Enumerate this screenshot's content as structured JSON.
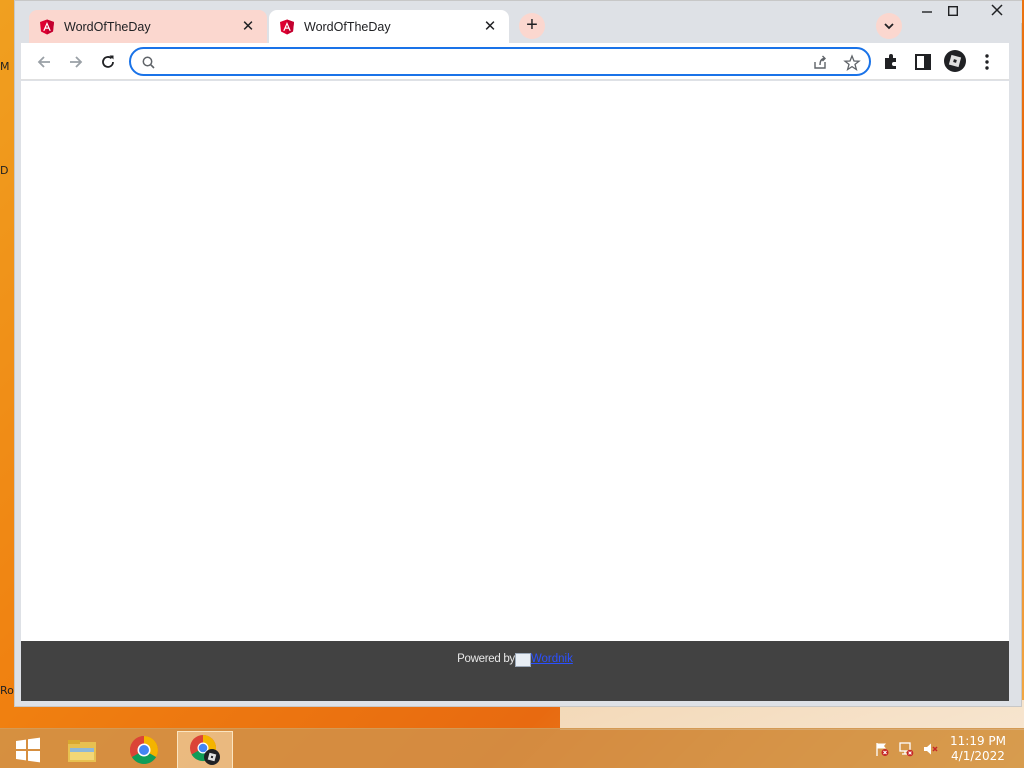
{
  "desktop": {
    "labels": [
      "M",
      "D",
      "Ro"
    ]
  },
  "browser": {
    "tabs": [
      {
        "title": "WordOfTheDay",
        "favicon": "angular-icon",
        "active": false
      },
      {
        "title": "WordOfTheDay",
        "favicon": "angular-icon",
        "active": true
      }
    ],
    "new_tab_label": "+",
    "omnibox": {
      "value": "",
      "placeholder": ""
    },
    "accent_color": "#1a73e8",
    "tab_tint_color": "#fbd7cf"
  },
  "page": {
    "footer": {
      "powered_by": "Powered by",
      "link_text": "Wordnik"
    }
  },
  "taskbar": {
    "apps": [
      "windows-start-icon",
      "file-explorer-icon",
      "chrome-icon",
      "chrome-roblox-icon"
    ],
    "clock": {
      "time": "11:19 PM",
      "date": "4/1/2022"
    }
  }
}
